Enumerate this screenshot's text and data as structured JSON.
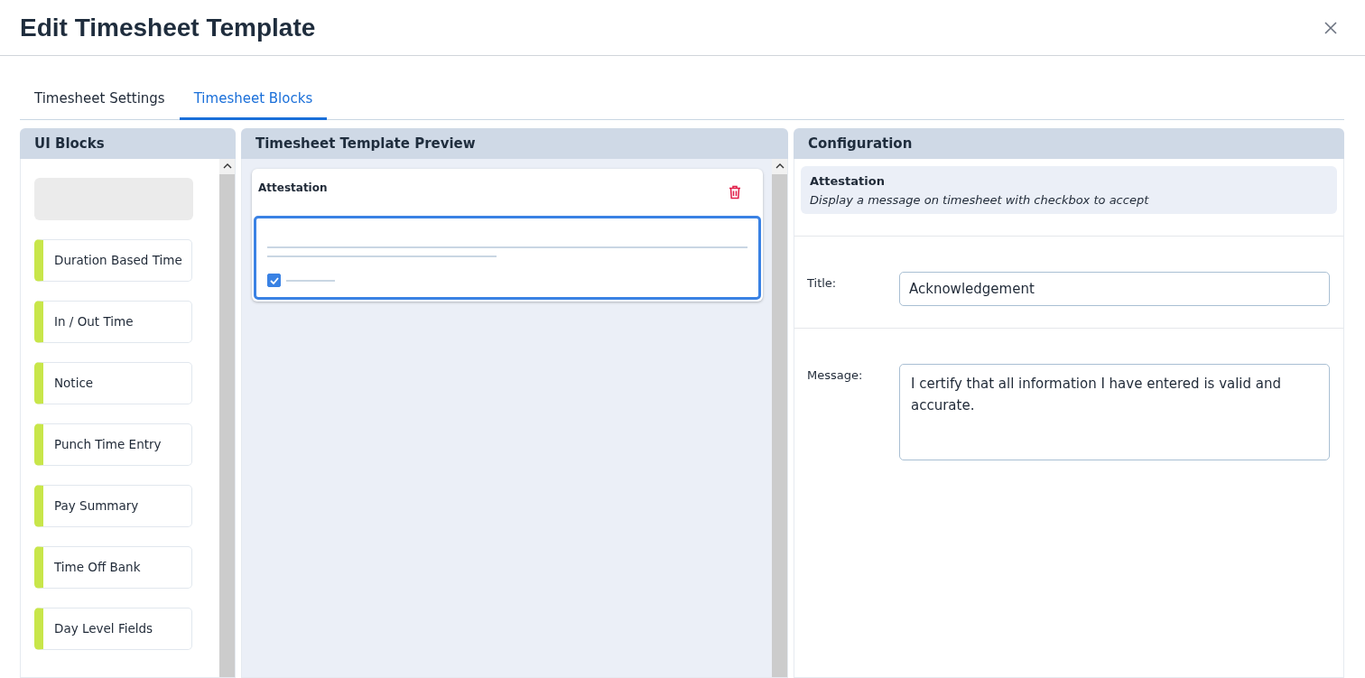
{
  "dialog": {
    "title": "Edit Timesheet Template"
  },
  "tabs": [
    {
      "label": "Timesheet Settings",
      "selected": false
    },
    {
      "label": "Timesheet Blocks",
      "selected": true
    }
  ],
  "ui_blocks": {
    "title": "UI Blocks",
    "items": [
      {
        "label": "Duration Based Time"
      },
      {
        "label": "In / Out Time"
      },
      {
        "label": "Notice"
      },
      {
        "label": "Punch Time Entry"
      },
      {
        "label": "Pay Summary"
      },
      {
        "label": "Time Off Bank"
      },
      {
        "label": "Day Level Fields"
      }
    ]
  },
  "preview": {
    "title": "Timesheet Template Preview",
    "blocks": [
      {
        "title": "Attestation",
        "selected": true,
        "checked": true
      }
    ]
  },
  "configuration": {
    "title": "Configuration",
    "block_name": "Attestation",
    "block_description": "Display a message on timesheet with checkbox to accept",
    "fields": [
      {
        "kind": "text",
        "label": "Title:",
        "value": "Acknowledgement"
      },
      {
        "kind": "textarea",
        "label": "Message:",
        "value": "I certify that all information I have entered is valid and accurate."
      }
    ]
  }
}
